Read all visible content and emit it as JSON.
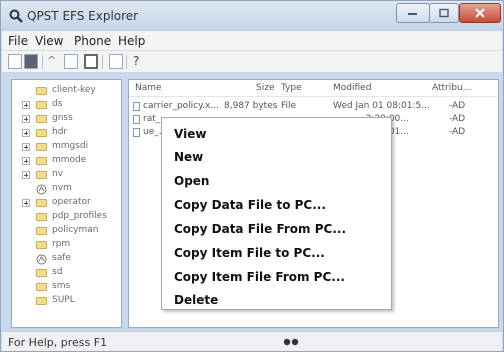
{
  "window": {
    "title": "QPST EFS Explorer"
  },
  "menubar": {
    "items": [
      "File",
      "View",
      "Phone",
      "Help"
    ]
  },
  "toolbar": {
    "help_label": "?"
  },
  "tree": {
    "items": [
      {
        "label": "client-key",
        "expandable": false
      },
      {
        "label": "ds",
        "expandable": true
      },
      {
        "label": "gnss",
        "expandable": true
      },
      {
        "label": "hdr",
        "expandable": true
      },
      {
        "label": "mmgsdi",
        "expandable": true
      },
      {
        "label": "mmode",
        "expandable": true
      },
      {
        "label": "nv",
        "expandable": true
      },
      {
        "label": "nvm",
        "expandable": false
      },
      {
        "label": "operator",
        "expandable": true
      },
      {
        "label": "pdp_profiles",
        "expandable": false
      },
      {
        "label": "policyman",
        "expandable": false
      },
      {
        "label": "rpm",
        "expandable": false
      },
      {
        "label": "safe",
        "expandable": false
      },
      {
        "label": "sd",
        "expandable": false
      },
      {
        "label": "sms",
        "expandable": false
      },
      {
        "label": "SUPL",
        "expandable": false
      }
    ]
  },
  "file_list": {
    "columns": [
      "Name",
      "Size",
      "Type",
      "Modified",
      "Attribu..."
    ],
    "rows": [
      {
        "name": "carrier_policy.x...",
        "size": "8,987 bytes",
        "type": "File",
        "modified": "Wed Jan 01 08:01:5...",
        "attributes": "-AD"
      },
      {
        "name": "rat_...",
        "size": "",
        "type": "",
        "modified": "...2:20:00...",
        "attributes": "-AD"
      },
      {
        "name": "ue_...",
        "size": "",
        "type": "",
        "modified": "...2:20:01...",
        "attributes": "-AD"
      }
    ]
  },
  "context_menu": {
    "items": [
      "View",
      "New",
      "Open",
      "Copy Data File to PC...",
      "Copy Data File From PC...",
      "Copy Item File to PC...",
      "Copy Item File From PC...",
      "Delete"
    ]
  },
  "statusbar": {
    "text": "For Help, press F1"
  }
}
